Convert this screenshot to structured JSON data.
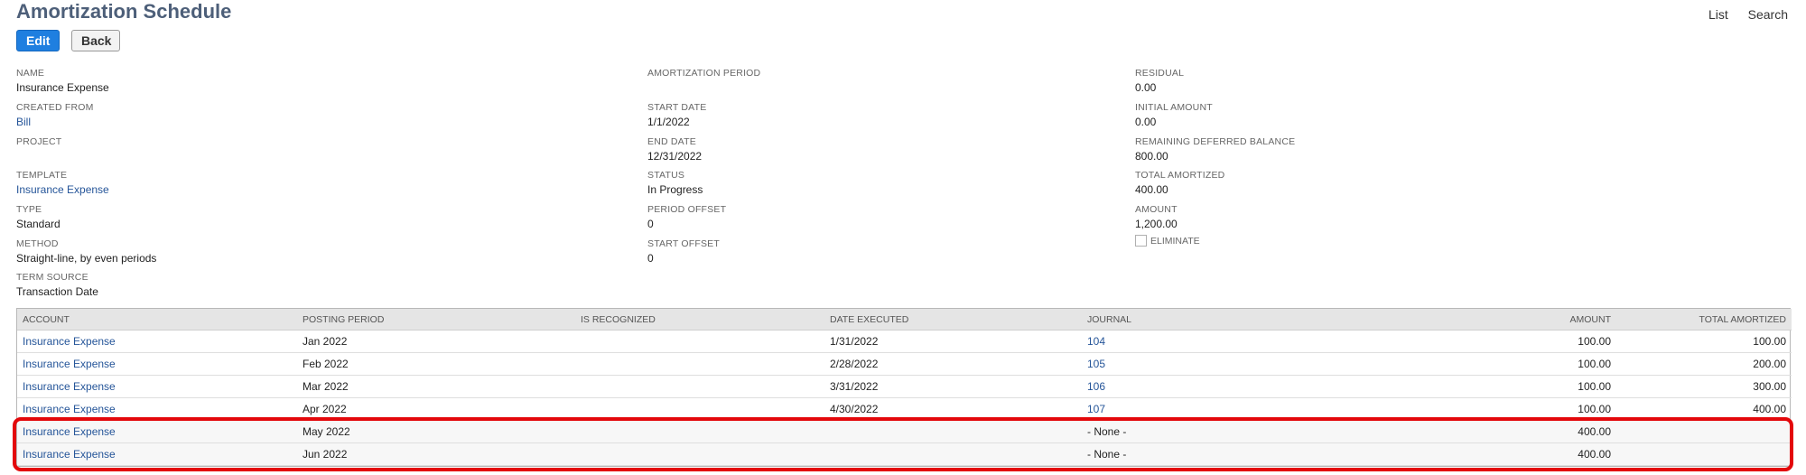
{
  "page": {
    "title": "Amortization Schedule"
  },
  "top_links": {
    "list": "List",
    "search": "Search"
  },
  "buttons": {
    "edit": "Edit",
    "back": "Back"
  },
  "fields": {
    "name": {
      "label": "NAME",
      "value": "Insurance Expense"
    },
    "created_from": {
      "label": "CREATED FROM",
      "value": "Bill"
    },
    "project": {
      "label": "PROJECT",
      "value": ""
    },
    "template": {
      "label": "TEMPLATE",
      "value": "Insurance Expense"
    },
    "type": {
      "label": "TYPE",
      "value": "Standard"
    },
    "method": {
      "label": "METHOD",
      "value": "Straight-line, by even periods"
    },
    "term_source": {
      "label": "TERM SOURCE",
      "value": "Transaction Date"
    },
    "amortization_period": {
      "label": "AMORTIZATION PERIOD",
      "value": ""
    },
    "start_date": {
      "label": "START DATE",
      "value": "1/1/2022"
    },
    "end_date": {
      "label": "END DATE",
      "value": "12/31/2022"
    },
    "status": {
      "label": "STATUS",
      "value": "In Progress"
    },
    "period_offset": {
      "label": "PERIOD OFFSET",
      "value": "0"
    },
    "start_offset": {
      "label": "START OFFSET",
      "value": "0"
    },
    "residual": {
      "label": "RESIDUAL",
      "value": "0.00"
    },
    "initial_amount": {
      "label": "INITIAL AMOUNT",
      "value": "0.00"
    },
    "remaining_deferred_balance": {
      "label": "REMAINING DEFERRED BALANCE",
      "value": "800.00"
    },
    "total_amortized": {
      "label": "TOTAL AMORTIZED",
      "value": "400.00"
    },
    "amount": {
      "label": "AMOUNT",
      "value": "1,200.00"
    },
    "eliminate": {
      "label": "ELIMINATE",
      "checked": false
    }
  },
  "table": {
    "headers": [
      "ACCOUNT",
      "POSTING PERIOD",
      "IS RECOGNIZED",
      "DATE EXECUTED",
      "JOURNAL",
      "AMOUNT",
      "TOTAL AMORTIZED"
    ],
    "rows": [
      [
        "Insurance Expense",
        "Jan 2022",
        "",
        "1/31/2022",
        "104",
        "100.00",
        "100.00"
      ],
      [
        "Insurance Expense",
        "Feb 2022",
        "",
        "2/28/2022",
        "105",
        "100.00",
        "200.00"
      ],
      [
        "Insurance Expense",
        "Mar 2022",
        "",
        "3/31/2022",
        "106",
        "100.00",
        "300.00"
      ],
      [
        "Insurance Expense",
        "Apr 2022",
        "",
        "4/30/2022",
        "107",
        "100.00",
        "400.00"
      ],
      [
        "Insurance Expense",
        "May 2022",
        "",
        "",
        "- None -",
        "400.00",
        ""
      ],
      [
        "Insurance Expense",
        "Jun 2022",
        "",
        "",
        "- None -",
        "400.00",
        ""
      ]
    ]
  },
  "colors": {
    "highlight": "#e3080b",
    "link": "#255599",
    "primary_button": "#1f7fe0"
  }
}
